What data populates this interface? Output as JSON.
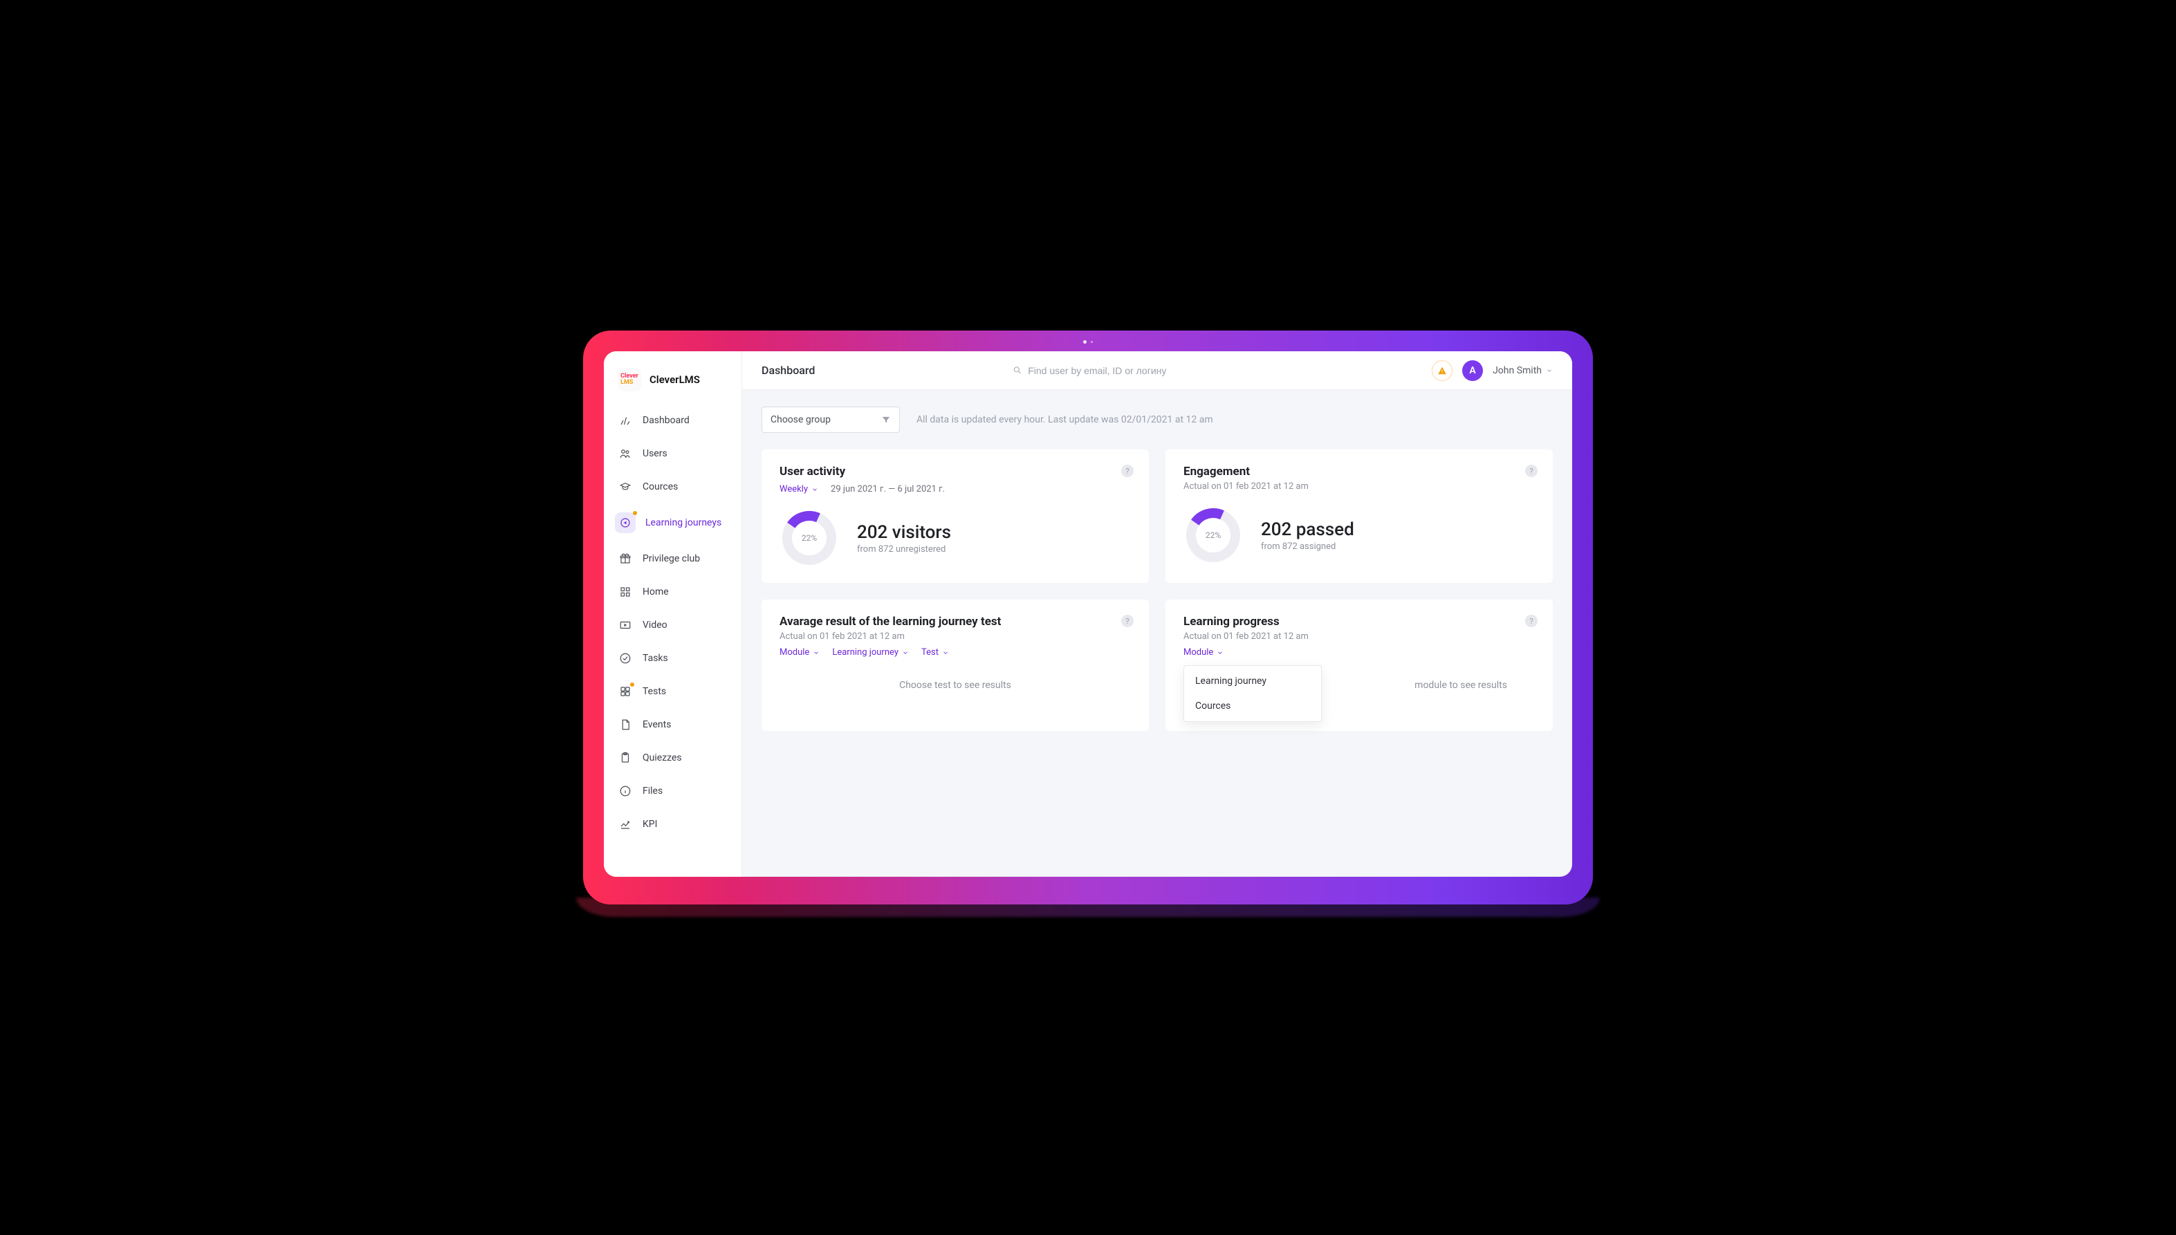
{
  "brand": {
    "name": "CleverLMS",
    "logo_top": "Clever",
    "logo_bottom": "LMS"
  },
  "sidebar": {
    "items": [
      {
        "label": "Dashboard",
        "icon": "bar-chart-icon",
        "active": false,
        "dot": false
      },
      {
        "label": "Users",
        "icon": "users-icon",
        "active": false,
        "dot": false
      },
      {
        "label": "Cources",
        "icon": "graduation-icon",
        "active": false,
        "dot": false
      },
      {
        "label": "Learning journeys",
        "icon": "arrow-loop-icon",
        "active": true,
        "dot": true
      },
      {
        "label": "Privilege club",
        "icon": "gift-icon",
        "active": false,
        "dot": false
      },
      {
        "label": "Home",
        "icon": "grid-icon",
        "active": false,
        "dot": false
      },
      {
        "label": "Video",
        "icon": "play-icon",
        "active": false,
        "dot": false
      },
      {
        "label": "Tasks",
        "icon": "check-circle-icon",
        "active": false,
        "dot": false
      },
      {
        "label": "Tests",
        "icon": "squares-icon",
        "active": false,
        "dot": true
      },
      {
        "label": "Events",
        "icon": "document-icon",
        "active": false,
        "dot": false
      },
      {
        "label": "Quiezzes",
        "icon": "clipboard-icon",
        "active": false,
        "dot": false
      },
      {
        "label": "Files",
        "icon": "info-icon",
        "active": false,
        "dot": false
      },
      {
        "label": "KPI",
        "icon": "trend-icon",
        "active": false,
        "dot": false
      }
    ]
  },
  "header": {
    "title": "Dashboard",
    "search_placeholder": "Find user by email, ID or логину",
    "user_name": "John Smith",
    "avatar_initial": "A"
  },
  "filters": {
    "group_label": "Choose group",
    "update_info": "All data is updated every hour. Last update was 02/01/2021 at 12 am"
  },
  "cards": {
    "user_activity": {
      "title": "User activity",
      "period_label": "Weekly",
      "date_range": "29 jun 2021 г. — 6 jul 2021 г.",
      "donut_label": "22%",
      "metric": "202 visitors",
      "metric_sub": "from 872 unregistered"
    },
    "engagement": {
      "title": "Engagement",
      "subtitle": "Actual on 01 feb 2021 at 12 am",
      "donut_label": "22%",
      "metric": "202 passed",
      "metric_sub": "from 872 assigned"
    },
    "average_result": {
      "title": "Avarage result of the learning journey test",
      "subtitle": "Actual on 01 feb 2021 at 12 am",
      "filters": {
        "module": "Module",
        "journey": "Learning journey",
        "test": "Test"
      },
      "empty": "Choose test to see results"
    },
    "learning_progress": {
      "title": "Learning progress",
      "subtitle": "Actual on 01 feb 2021 at 12 am",
      "filter_module": "Module",
      "dropdown": [
        "Learning journey",
        "Cources"
      ],
      "empty": "module to see results"
    }
  },
  "chart_data": [
    {
      "type": "pie",
      "title": "User activity",
      "series": [
        {
          "name": "visitors",
          "value": 22
        },
        {
          "name": "remaining",
          "value": 78
        }
      ],
      "annotations": {
        "count": 202,
        "total": 872,
        "percent": 22
      }
    },
    {
      "type": "pie",
      "title": "Engagement",
      "series": [
        {
          "name": "passed",
          "value": 22
        },
        {
          "name": "remaining",
          "value": 78
        }
      ],
      "annotations": {
        "count": 202,
        "total": 872,
        "percent": 22
      }
    }
  ],
  "colors": {
    "accent": "#7c3aed",
    "muted": "#8e919b",
    "track": "#ececf2"
  }
}
